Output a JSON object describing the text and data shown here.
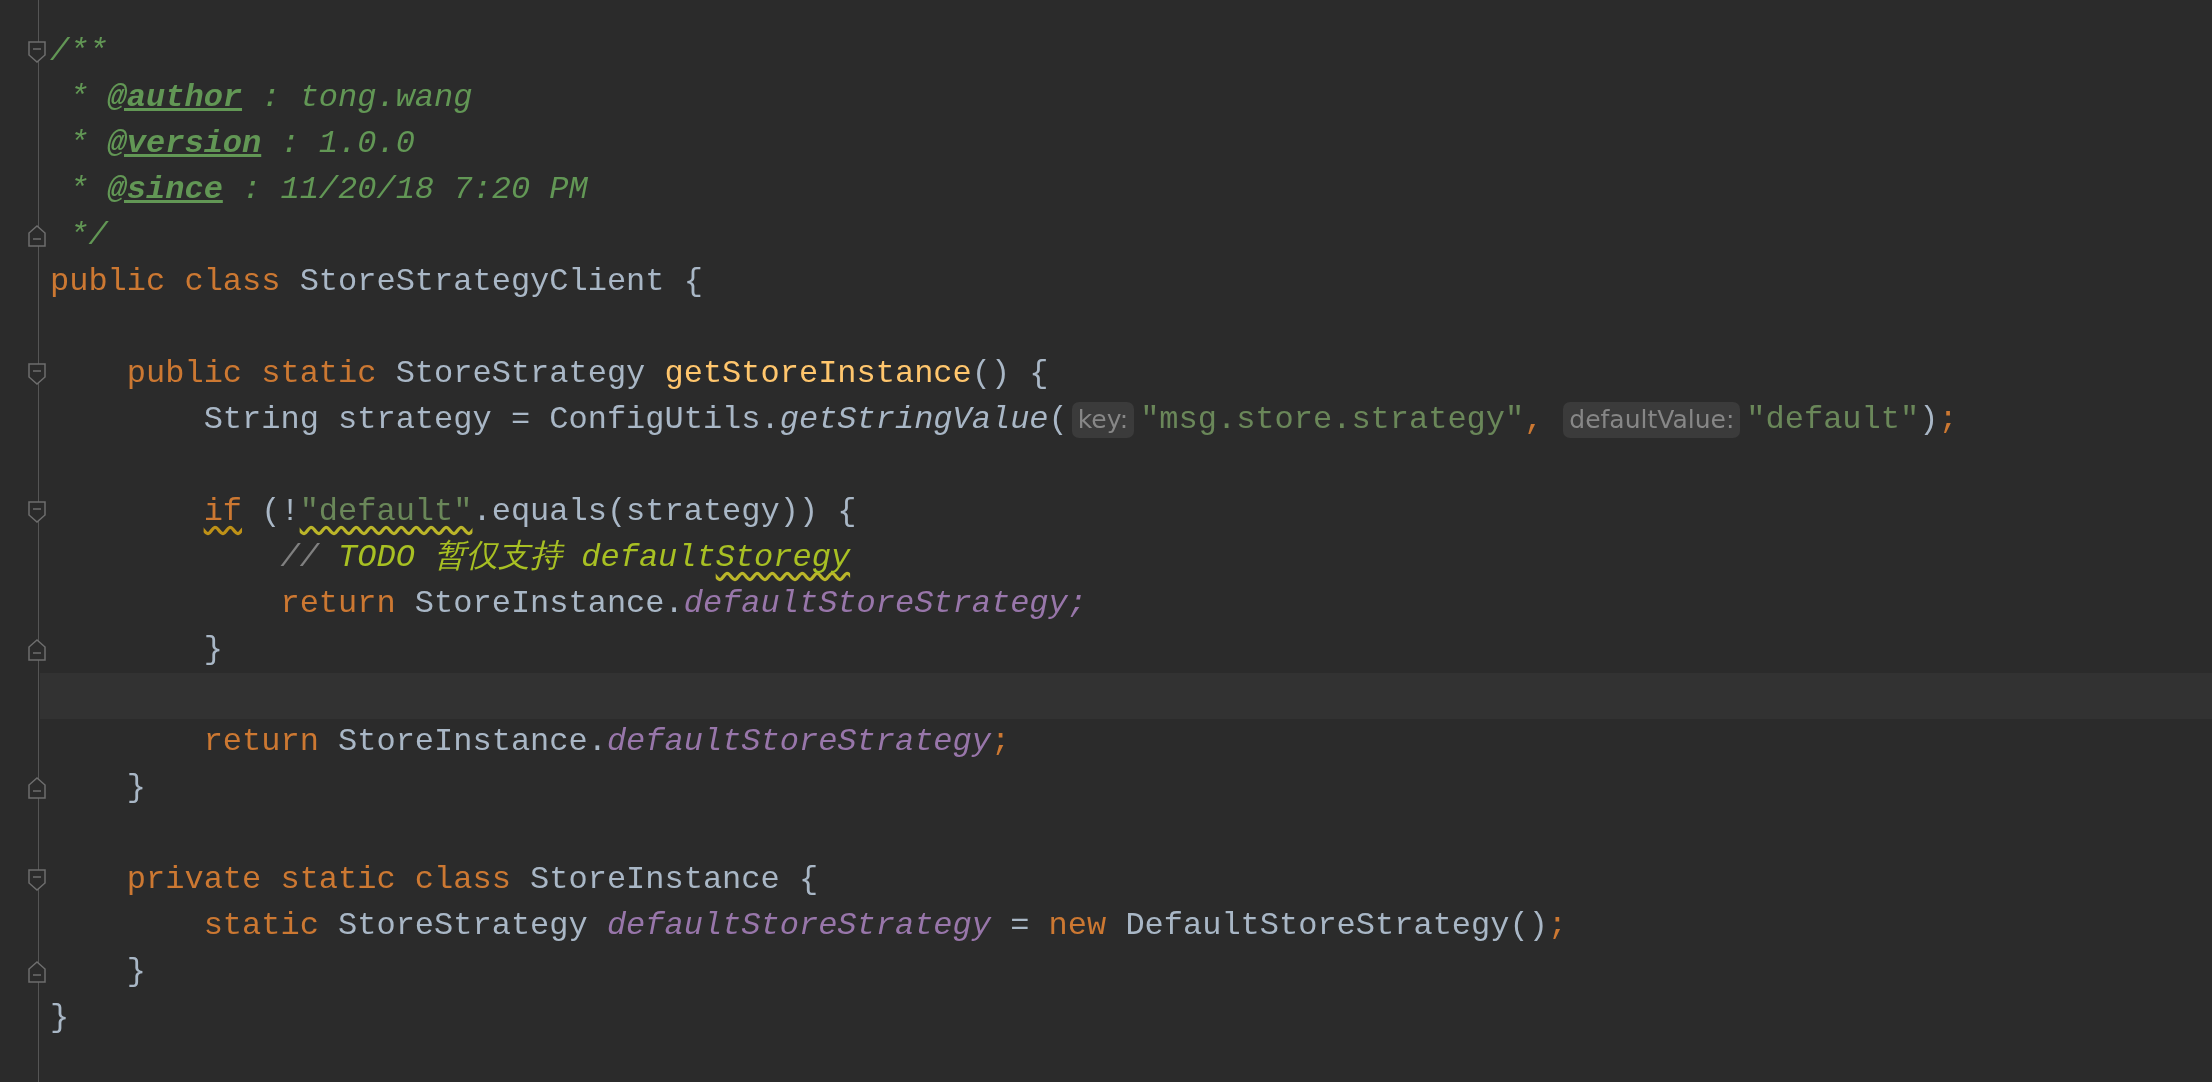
{
  "editor": {
    "lines": [
      {
        "kind": "code",
        "fold_start": true,
        "tokens": [
          {
            "kind": "comment",
            "text": "/**"
          }
        ]
      },
      {
        "kind": "code",
        "tokens": [
          {
            "kind": "comment",
            "text": " * "
          },
          {
            "kind": "doctag",
            "text": "@author"
          },
          {
            "kind": "comment",
            "text": " : tong.wang"
          }
        ]
      },
      {
        "kind": "code",
        "tokens": [
          {
            "kind": "comment",
            "text": " * "
          },
          {
            "kind": "doctag",
            "text": "@version"
          },
          {
            "kind": "comment",
            "text": " : 1.0.0"
          }
        ]
      },
      {
        "kind": "code",
        "tokens": [
          {
            "kind": "comment",
            "text": " * "
          },
          {
            "kind": "doctag",
            "text": "@since"
          },
          {
            "kind": "comment",
            "text": " : 11/20/18 7:20 PM"
          }
        ]
      },
      {
        "kind": "code",
        "fold_end": true,
        "tokens": [
          {
            "kind": "comment",
            "text": " */"
          }
        ]
      },
      {
        "kind": "code",
        "tokens": [
          {
            "kind": "keyword",
            "text": "public class"
          },
          {
            "kind": "identifier",
            "text": "StoreStrategyClient {",
            "gap": true
          }
        ],
        "children": [
          {
            "kind": "blank"
          },
          {
            "kind": "code",
            "fold_start": true,
            "tokens": [
              {
                "kind": "keyword",
                "text": "public static"
              },
              {
                "kind": "identifier",
                "text": "StoreStrategy",
                "gap": true
              },
              {
                "kind": "method",
                "text": "getStoreInstance",
                "gap": true
              },
              {
                "kind": "identifier",
                "text": "() {"
              }
            ],
            "children": [
              {
                "kind": "code",
                "tokens": [
                  {
                    "kind": "identifier",
                    "text": "String strategy = ConfigUtils."
                  },
                  {
                    "kind": "call",
                    "text": "getStringValue"
                  },
                  {
                    "kind": "identifier",
                    "text": "("
                  },
                  {
                    "kind": "hint",
                    "text": "key:"
                  },
                  {
                    "kind": "string",
                    "text": "\"msg.store.strategy\""
                  },
                  {
                    "kind": "punct",
                    "text": ","
                  },
                  {
                    "kind": "hint",
                    "text": "defaultValue:",
                    "gap": true
                  },
                  {
                    "kind": "string",
                    "text": "\"default\""
                  },
                  {
                    "kind": "identifier",
                    "text": ")"
                  },
                  {
                    "kind": "punct",
                    "text": ";"
                  }
                ]
              },
              {
                "kind": "blank"
              },
              {
                "kind": "code",
                "fold_start": true,
                "tokens": [
                  {
                    "kind": "keyword",
                    "text": "if",
                    "squiggle": true
                  },
                  {
                    "kind": "identifier",
                    "text": "(!",
                    "gap": true
                  },
                  {
                    "kind": "string",
                    "text": "\"default\"",
                    "squiggle": true
                  },
                  {
                    "kind": "identifier",
                    "text": ".equals(strategy)) {"
                  }
                ],
                "children": [
                  {
                    "kind": "code",
                    "tokens": [
                      {
                        "kind": "linecomment",
                        "text": "//"
                      },
                      {
                        "kind": "todo",
                        "text": "TODO 暂仅支持 default",
                        "gap": true
                      },
                      {
                        "kind": "todo",
                        "text": "Storegy",
                        "squiggle": true
                      }
                    ]
                  },
                  {
                    "kind": "code",
                    "tokens": [
                      {
                        "kind": "keyword",
                        "text": "return"
                      },
                      {
                        "kind": "identifier",
                        "text": "StoreInstance.",
                        "gap": true
                      },
                      {
                        "kind": "field",
                        "text": "defaultStoreStrategy;"
                      }
                    ]
                  }
                ]
              },
              {
                "kind": "code",
                "fold_end": true,
                "tokens": [
                  {
                    "kind": "identifier",
                    "text": "}"
                  }
                ]
              },
              {
                "kind": "blank",
                "current": true
              },
              {
                "kind": "code",
                "tokens": [
                  {
                    "kind": "keyword",
                    "text": "return"
                  },
                  {
                    "kind": "identifier",
                    "text": "StoreInstance.",
                    "gap": true
                  },
                  {
                    "kind": "field",
                    "text": "defaultStoreStrategy"
                  },
                  {
                    "kind": "punct",
                    "text": ";"
                  }
                ]
              }
            ]
          },
          {
            "kind": "code",
            "fold_end": true,
            "tokens": [
              {
                "kind": "identifier",
                "text": "}"
              }
            ]
          },
          {
            "kind": "blank"
          },
          {
            "kind": "code",
            "fold_start": true,
            "tokens": [
              {
                "kind": "keyword",
                "text": "private static class"
              },
              {
                "kind": "identifier",
                "text": "StoreInstance {",
                "gap": true
              }
            ],
            "children": [
              {
                "kind": "code",
                "tokens": [
                  {
                    "kind": "keyword",
                    "text": "static"
                  },
                  {
                    "kind": "identifier",
                    "text": "StoreStrategy",
                    "gap": true
                  },
                  {
                    "kind": "field",
                    "text": "defaultStoreStrategy",
                    "gap": true
                  },
                  {
                    "kind": "identifier",
                    "text": "=",
                    "gap": true
                  },
                  {
                    "kind": "keyword",
                    "text": "new",
                    "gap": true
                  },
                  {
                    "kind": "identifier",
                    "text": "DefaultStoreStrategy()",
                    "gap": true
                  },
                  {
                    "kind": "punct",
                    "text": ";"
                  }
                ]
              }
            ]
          },
          {
            "kind": "code",
            "fold_end": true,
            "tokens": [
              {
                "kind": "identifier",
                "text": "}"
              }
            ]
          }
        ]
      },
      {
        "kind": "code",
        "tokens": [
          {
            "kind": "identifier",
            "text": "}"
          }
        ]
      }
    ]
  }
}
